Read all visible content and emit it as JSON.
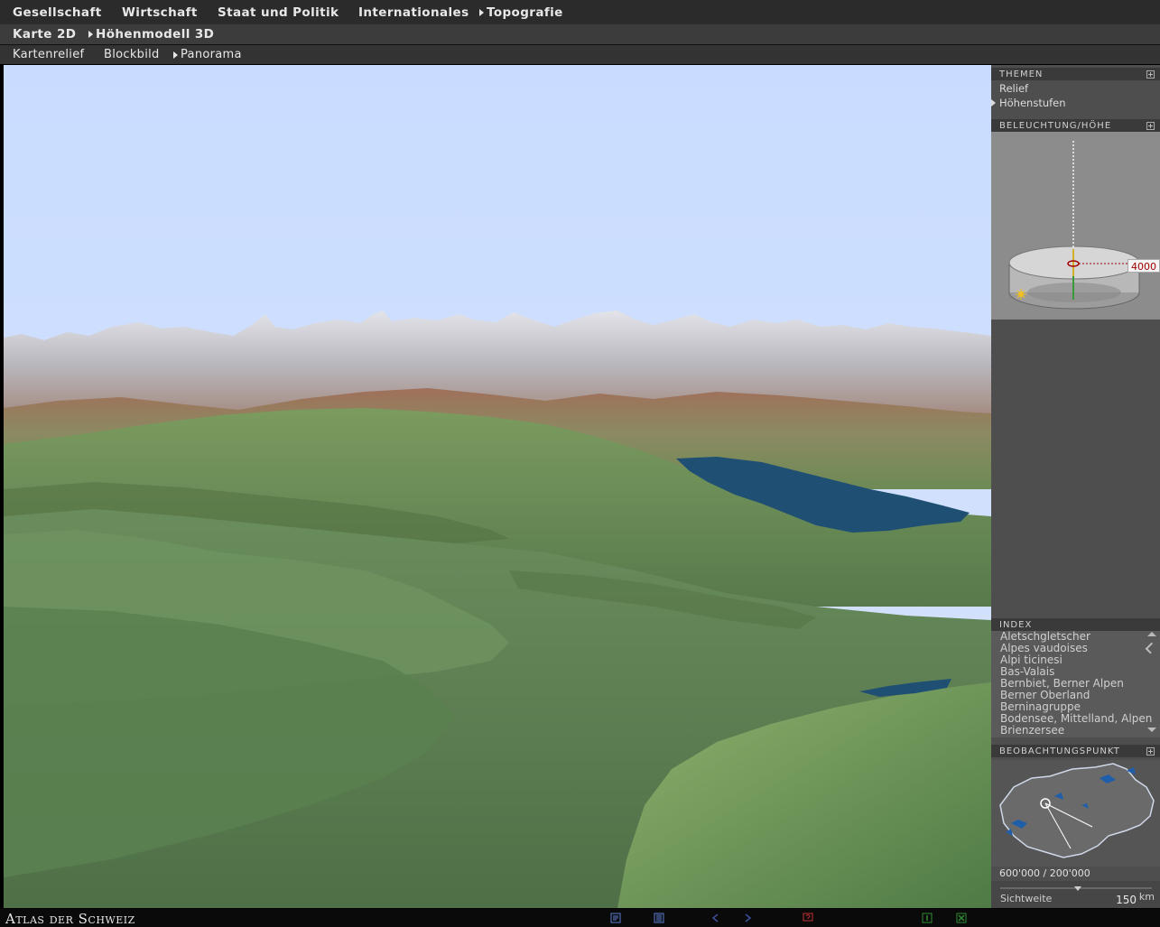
{
  "nav": {
    "top": [
      {
        "label": "Gesellschaft",
        "active": false
      },
      {
        "label": "Wirtschaft",
        "active": false
      },
      {
        "label": "Staat und Politik",
        "active": false
      },
      {
        "label": "Internationales",
        "active": false
      },
      {
        "label": "Topografie",
        "active": true
      }
    ],
    "second": [
      {
        "label": "Karte 2D",
        "active": false
      },
      {
        "label": "Höhenmodell 3D",
        "active": true
      }
    ],
    "third": [
      {
        "label": "Kartenrelief",
        "active": false
      },
      {
        "label": "Blockbild",
        "active": false
      },
      {
        "label": "Panorama",
        "active": true
      }
    ]
  },
  "panel": {
    "themen": {
      "title": "THEMEN",
      "items": [
        {
          "label": "Relief",
          "active": false
        },
        {
          "label": "Höhenstufen",
          "active": true
        }
      ]
    },
    "beleuchtung": {
      "title": "BELEUCHTUNG/HÖHE",
      "height_value": "4000"
    },
    "index": {
      "title": "INDEX",
      "items": [
        "Aletschgletscher",
        "Alpes vaudoises",
        "Alpi ticinesi",
        "Bas-Valais",
        "Bernbiet, Berner Alpen",
        "Berner Oberland",
        "Berninagruppe",
        "Bodensee, Mittelland, Alpen",
        "Brienzersee"
      ]
    },
    "beobachtung": {
      "title": "BEOBACHTUNGSPUNKT",
      "coordinates": "600'000 / 200'000"
    },
    "sichtweite": {
      "label": "Sichtweite",
      "value": "150",
      "unit": "km"
    }
  },
  "footer": {
    "brand": "Atlas der Schweiz",
    "icons": [
      "legend-icon",
      "text-icon",
      "back-arrow-icon",
      "forward-arrow-icon",
      "help-icon",
      "info-icon",
      "close-icon"
    ]
  },
  "colors": {
    "sky": "#cfe0ff",
    "lake": "#1f4f72",
    "valley": "#5e8556",
    "mountains_high": "#c8c8cc",
    "mountains_mid": "#a37a66",
    "highlight_red": "#a00000",
    "panel": "#4e4e4e"
  }
}
